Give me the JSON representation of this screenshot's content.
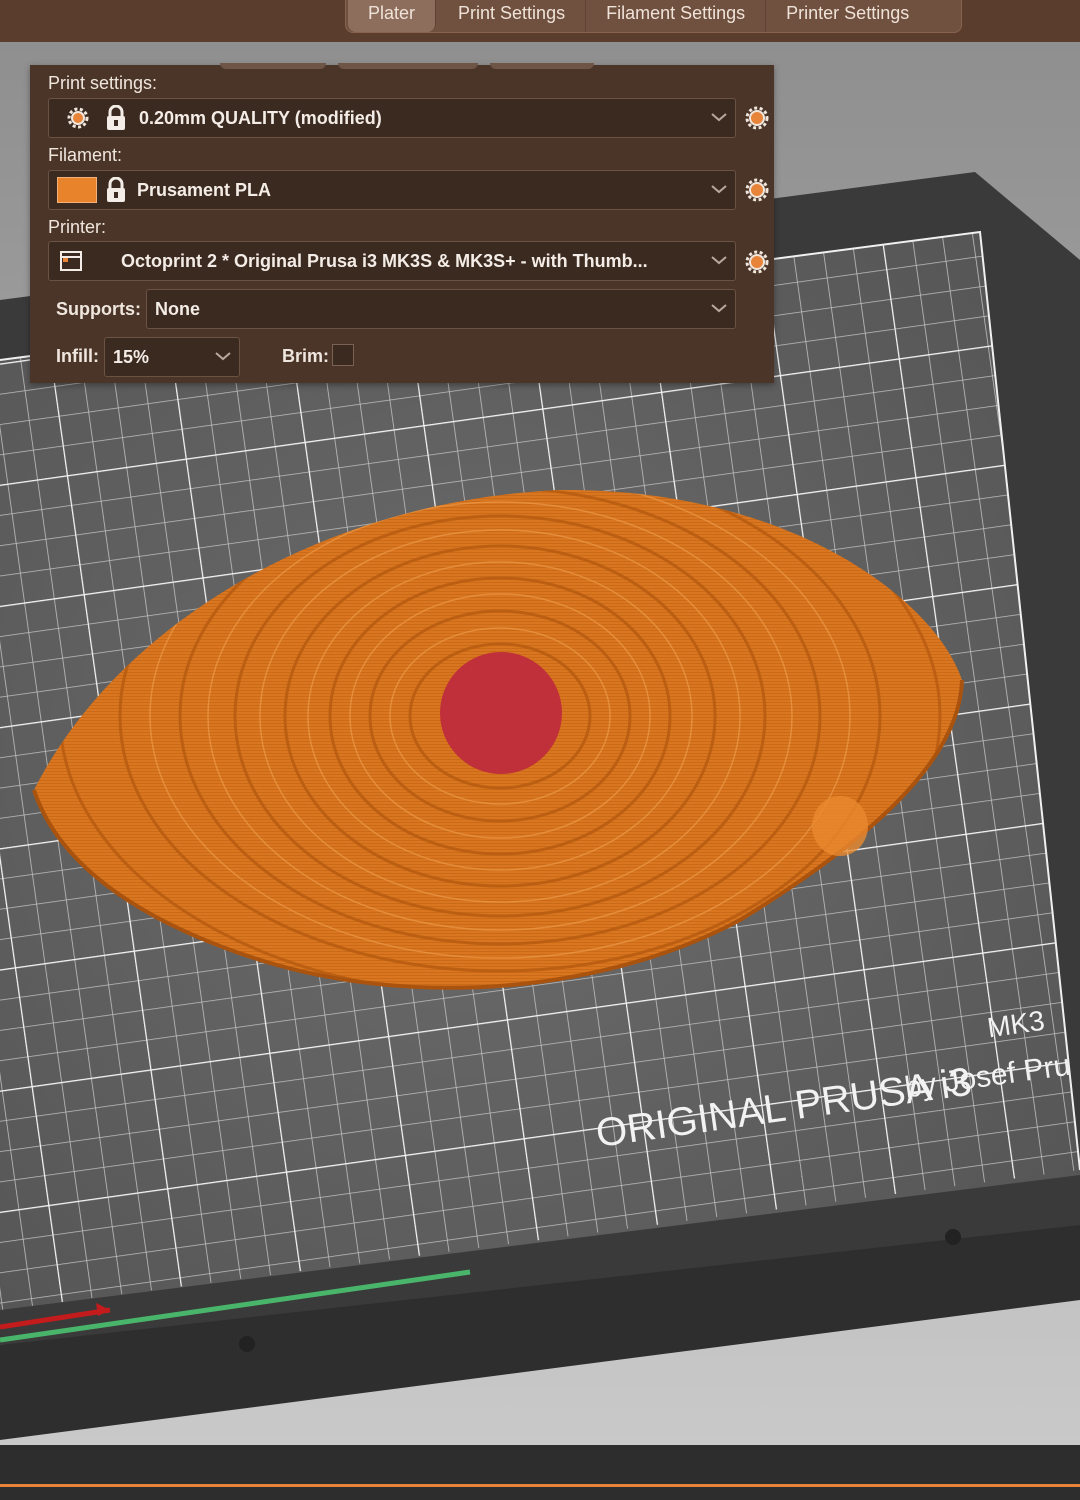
{
  "tabs": [
    {
      "label": "Plater",
      "active": true
    },
    {
      "label": "Print Settings",
      "active": false
    },
    {
      "label": "Filament Settings",
      "active": false
    },
    {
      "label": "Printer Settings",
      "active": false
    }
  ],
  "panel": {
    "print_settings_label": "Print settings:",
    "print_profile": "0.20mm QUALITY (modified)",
    "filament_label": "Filament:",
    "filament_profile": "Prusament PLA",
    "filament_color": "#e8832b",
    "printer_label": "Printer:",
    "printer_profile": "Octoprint 2 * Original Prusa i3 MK3S & MK3S+ - with Thumb...",
    "supports_label": "Supports:",
    "supports_value": "None",
    "infill_label": "Infill:",
    "infill_value": "15%",
    "brim_label": "Brim:",
    "brim_checked": false
  },
  "bed": {
    "logo_line1": "ORIGINAL PRUSA i3",
    "logo_model": "MK3",
    "logo_line2": "by Josef Pru"
  },
  "colors": {
    "accent": "#e8843a",
    "toolbar_brown": "#5a3d2c",
    "panel_brown": "#4b3529",
    "model_orange": "#d9761f",
    "model_red_area": "#c0303a"
  }
}
